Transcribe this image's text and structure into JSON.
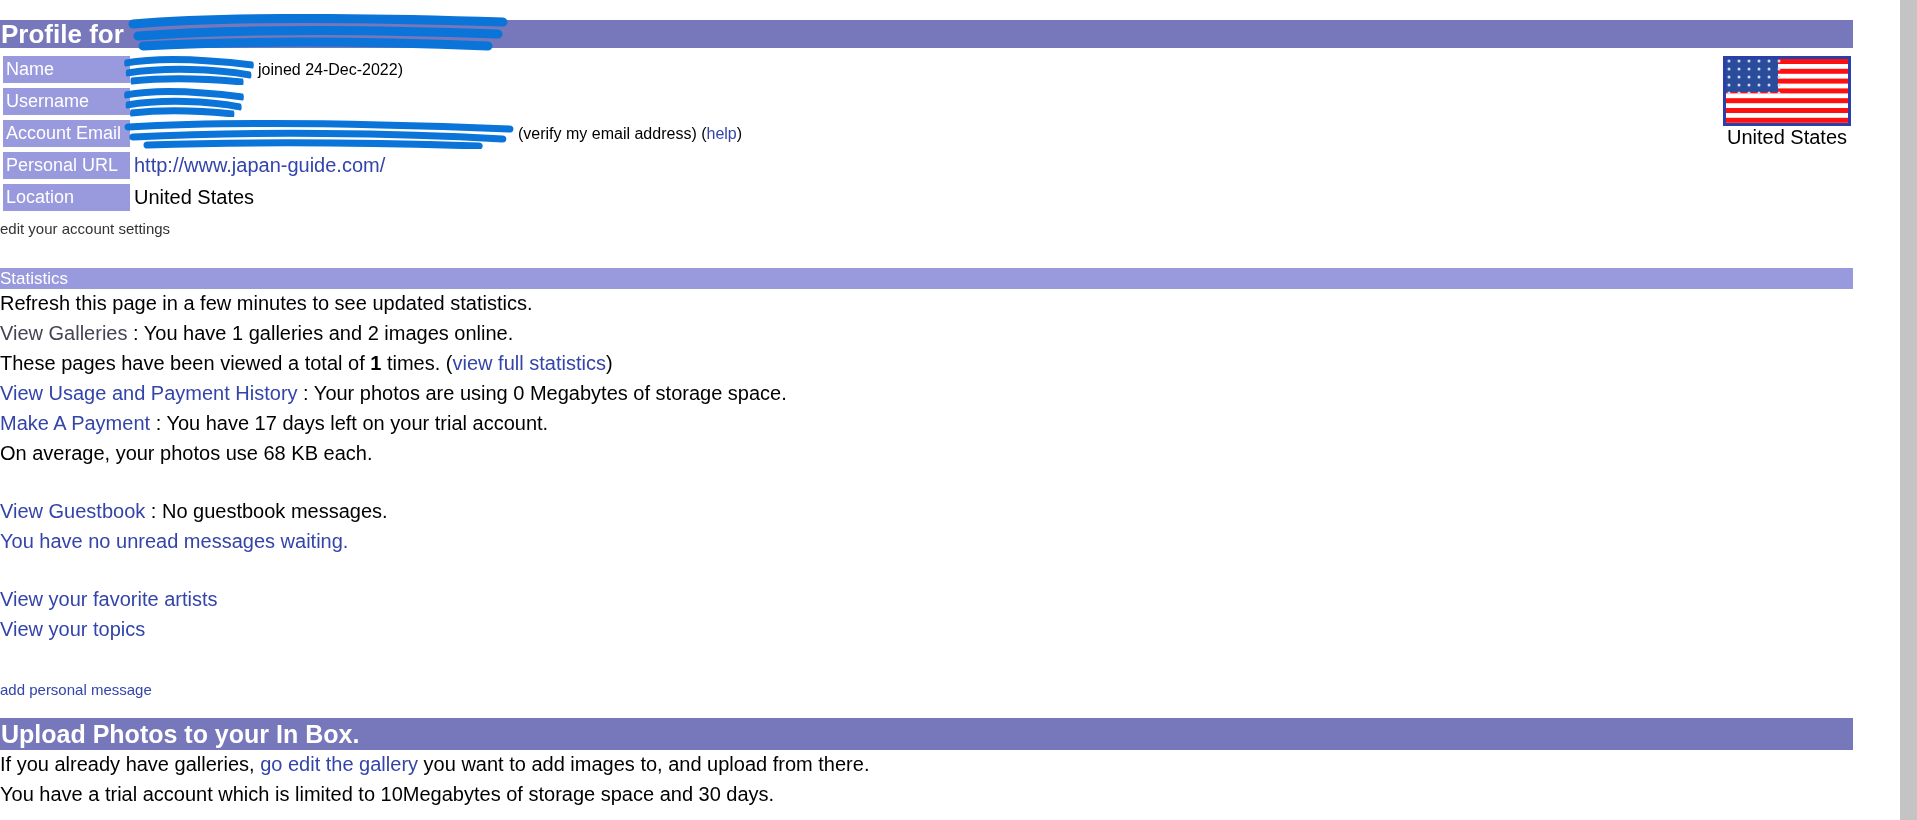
{
  "profile": {
    "title": "Profile for",
    "title_redacted": true,
    "fields": [
      {
        "label": "Name",
        "redacted": true,
        "segments": [
          {
            "text": "joined 24-Dec-2022)",
            "link": false
          }
        ]
      },
      {
        "label": "Username",
        "redacted": true
      },
      {
        "label": "Account Email",
        "redacted": true,
        "segments": [
          {
            "text": "(verify my email address) (",
            "link": false
          },
          {
            "text": "help",
            "link": true
          },
          {
            "text": ")",
            "link": false
          }
        ]
      },
      {
        "label": "Personal URL",
        "redacted": false,
        "segments": [
          {
            "text": "http://www.japan-guide.com/",
            "link": true
          }
        ]
      },
      {
        "label": "Location",
        "redacted": false,
        "segments": [
          {
            "text": "United States",
            "link": false
          }
        ]
      }
    ],
    "settings_link": "edit your account settings",
    "flag_caption": "United States"
  },
  "statistics": {
    "title": "Statistics",
    "groups": [
      [
        [
          {
            "text": "Refresh this page in a few minutes to see updated statistics.",
            "link": false
          }
        ],
        [
          {
            "text": "View Galleries",
            "link": true,
            "visited": true
          },
          {
            "text": " : You have 1 galleries and 2 images online.",
            "link": false
          }
        ],
        [
          {
            "text": "These pages have been viewed a total of **1** times. (",
            "link": false
          },
          {
            "text": "view full statistics",
            "link": true,
            "visited": false
          },
          {
            "text": ")",
            "link": false
          }
        ],
        [
          {
            "text": "View Usage and Payment History",
            "link": true,
            "visited": false
          },
          {
            "text": " : Your photos are using 0 Megabytes of storage space.",
            "link": false
          }
        ],
        [
          {
            "text": "Make A Payment",
            "link": true,
            "visited": false
          },
          {
            "text": " : You have 17 days left on your trial account.",
            "link": false
          }
        ],
        [
          {
            "text": "On average, your photos use 68 KB each.",
            "link": false
          }
        ]
      ],
      [
        [
          {
            "text": "View Guestbook",
            "link": true,
            "visited": false
          },
          {
            "text": " : No guestbook messages.",
            "link": false
          }
        ],
        [
          {
            "text": "You have no unread messages waiting.",
            "link": true,
            "visited": false
          }
        ]
      ],
      [
        [
          {
            "text": "View your favorite artists",
            "link": true,
            "visited": false
          }
        ],
        [
          {
            "text": "View your topics",
            "link": true,
            "visited": false
          }
        ]
      ]
    ],
    "personal_message_link": "add personal message"
  },
  "upload": {
    "title": "Upload Photos to your In Box.",
    "lines": [
      [
        {
          "text": "If you already have galleries, ",
          "link": false
        },
        {
          "text": "go edit the gallery",
          "link": true,
          "visited": false
        },
        {
          "text": " you want to add images to, and upload from there.",
          "link": false
        }
      ],
      [
        {
          "text": "You have a trial account which is limited to 10Megabytes of storage space and 30 days.",
          "link": false
        }
      ]
    ]
  }
}
